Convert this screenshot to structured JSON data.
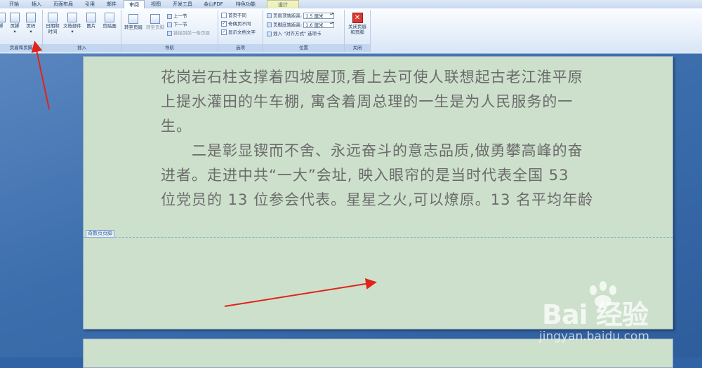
{
  "tabs": [
    "开始",
    "插入",
    "页面布局",
    "引用",
    "邮件",
    "审阅",
    "视图",
    "开发工具",
    "金山PDF",
    "特色功能",
    "设计"
  ],
  "ribbon": {
    "group1": {
      "label": "页眉和页脚",
      "btn_partial": "脚",
      "btn_footer": "页脚",
      "btn_pagenum": "页码"
    },
    "group2": {
      "label": "插入",
      "btn_datetime_1": "日期和",
      "btn_datetime_2": "时间",
      "btn_docparts": "文档部件",
      "btn_picture": "图片",
      "btn_clipart": "剪贴画"
    },
    "group3": {
      "label": "导航",
      "btn_goto_header": "转至页眉",
      "btn_goto_footer": "转至页脚",
      "btn_prev": "上一节",
      "btn_next": "下一节",
      "btn_link_prev": "链接到前一条页眉"
    },
    "group4": {
      "label": "选项",
      "opt_first_page": "首页不同",
      "opt_odd_even": "奇偶页不同",
      "opt_show_text": "显示文档文字",
      "opt_first_page_checked": false,
      "opt_odd_even_checked": true,
      "opt_show_text_checked": true
    },
    "group5": {
      "label": "位置",
      "header_top_label": "页眉顶端距离:",
      "header_top_value": "1.5 厘米",
      "footer_bottom_label": "页脚底端距离:",
      "footer_bottom_value": "1.6 厘米",
      "insert_align_tab": "插入 \"对齐方式\" 选项卡"
    },
    "group6": {
      "label": "关闭",
      "btn_close_1": "关闭页眉",
      "btn_close_2": "和页脚"
    }
  },
  "document": {
    "lines": [
      "花岗岩石柱支撑着四坡屋顶,看上去可使人联想起古老江淮平原",
      "上提水灌田的牛车棚, 寓含着周总理的一生是为人民服务的一",
      "生。",
      "　　二是彰显锲而不舍、永远奋斗的意志品质,做勇攀高峰的奋",
      "进者。走进中共“一大”会址, 映入眼帘的是当时代表全国 53",
      "位党员的 13 位参会代表。星星之火,可以燎原。13 名平均年龄"
    ],
    "footer_tag": "奇数页页脚"
  },
  "watermark": {
    "brand": "Bai 经验",
    "url": "jingyan.baidu.com"
  },
  "colors": {
    "page_bg": "#cde0cc",
    "annotation_arrow": "#e0231b",
    "ribbon_accent": "#c2d6ef"
  }
}
